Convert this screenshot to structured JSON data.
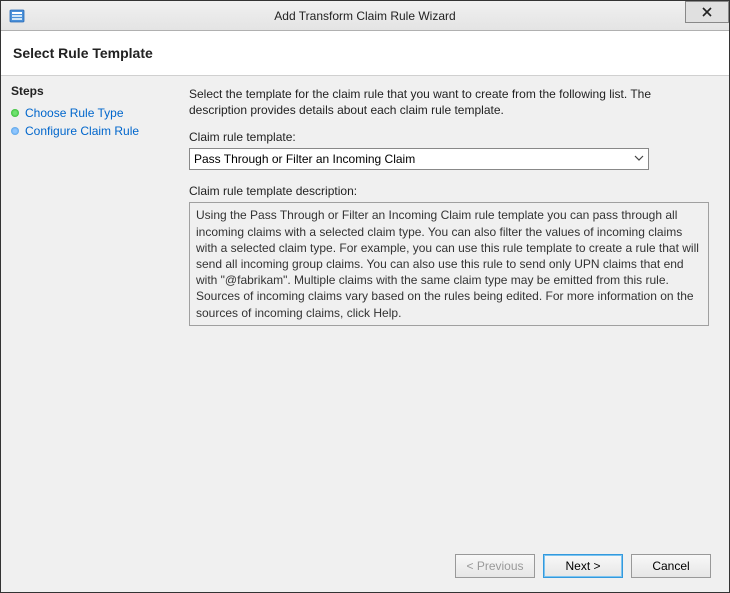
{
  "titlebar": {
    "title": "Add Transform Claim Rule Wizard"
  },
  "header": {
    "title": "Select Rule Template"
  },
  "sidebar": {
    "heading": "Steps",
    "items": [
      {
        "label": "Choose Rule Type"
      },
      {
        "label": "Configure Claim Rule"
      }
    ]
  },
  "main": {
    "instruction": "Select the template for the claim rule that you want to create from the following list. The description provides details about each claim rule template.",
    "template_label": "Claim rule template:",
    "template_selected": "Pass Through or Filter an Incoming Claim",
    "description_label": "Claim rule template description:",
    "description_text": "Using the Pass Through or Filter an Incoming Claim rule template you can pass through all incoming claims with a selected claim type.  You can also filter the values of incoming claims with a selected claim type.  For example, you can use this rule template to create a rule that will send all incoming group claims.  You can also use this rule to send only UPN claims that end with \"@fabrikam\".  Multiple claims with the same claim type may be emitted from this rule.  Sources of incoming claims vary based on the rules being edited.  For more information on the sources of incoming claims, click Help."
  },
  "buttons": {
    "previous": "< Previous",
    "next": "Next >",
    "cancel": "Cancel"
  }
}
